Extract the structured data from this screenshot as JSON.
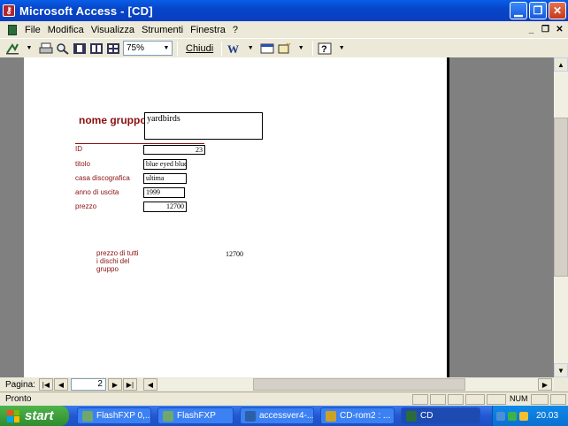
{
  "window": {
    "title": "Microsoft Access - [CD]"
  },
  "menu": {
    "items": [
      "File",
      "Modifica",
      "Visualizza",
      "Strumenti",
      "Finestra",
      "?"
    ]
  },
  "toolbar": {
    "zoom": "75%",
    "close_label": "Chiudi"
  },
  "report": {
    "group_label": "nome gruppo",
    "group_value": "yardbirds",
    "fields": [
      {
        "label": "ID",
        "value": "23"
      },
      {
        "label": "titolo",
        "value": "blue eyed blues"
      },
      {
        "label": "casa discografica",
        "value": "ultima"
      },
      {
        "label": "anno di uscita",
        "value": "1999"
      },
      {
        "label": "prezzo",
        "value": "12700"
      }
    ],
    "total_label_lines": [
      "prezzo di tutti",
      "i dischi del",
      "gruppo"
    ],
    "total_value": "12700"
  },
  "navigation": {
    "label": "Pagina:",
    "page": "2"
  },
  "status": {
    "text": "Pronto",
    "num": "NUM"
  },
  "taskbar": {
    "start_label": "start",
    "tasks": [
      {
        "label": "FlashFXP 0,...",
        "color": "#6ea86c"
      },
      {
        "label": "FlashFXP",
        "color": "#6ea86c"
      },
      {
        "label": "accessver4-...",
        "color": "#2b5fa8"
      },
      {
        "label": "CD-rom2 : ...",
        "color": "#c9a227"
      },
      {
        "label": "CD",
        "color": "#2c6b3a"
      }
    ],
    "clock": "20.03"
  }
}
